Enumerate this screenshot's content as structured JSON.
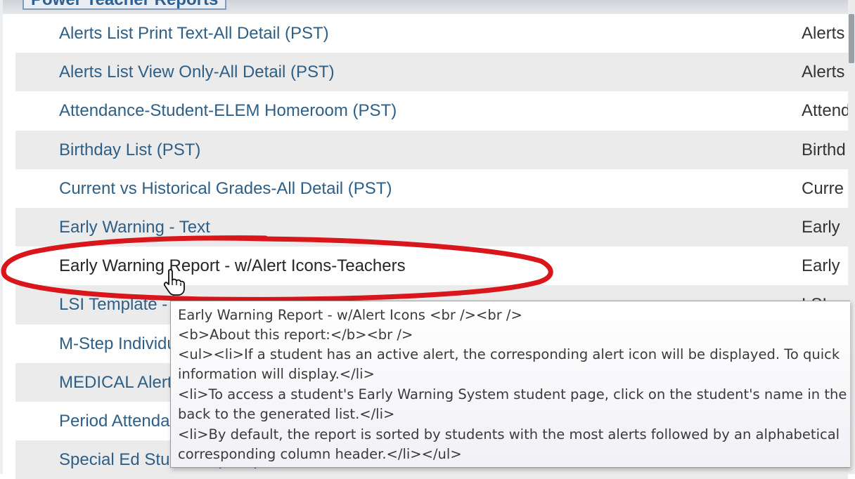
{
  "section": {
    "title": "Power Teacher Reports"
  },
  "reports": [
    {
      "name": "Alerts List Print Text-All Detail (PST)",
      "category": "Alerts"
    },
    {
      "name": "Alerts List View Only-All Detail (PST)",
      "category": "Alerts"
    },
    {
      "name": "Attendance-Student-ELEM Homeroom (PST)",
      "category": "Attend"
    },
    {
      "name": "Birthday List (PST)",
      "category": "Birthd"
    },
    {
      "name": "Current vs Historical Grades-All Detail (PST)",
      "category": "Curre"
    },
    {
      "name": "Early Warning - Text",
      "category": "Early"
    },
    {
      "name": "Early Warning Report - w/Alert Icons-Teachers",
      "category": "Early"
    },
    {
      "name": "LSI Template - Report (PST)",
      "category": "LSI"
    },
    {
      "name": "M-Step Individual",
      "category": ""
    },
    {
      "name": "MEDICAL Alerts",
      "category": ""
    },
    {
      "name": "Period Attendance",
      "category": ""
    },
    {
      "name": "Special Ed Students (PST)",
      "category": ""
    }
  ],
  "tooltip": {
    "lines": [
      "Early Warning Report - w/Alert Icons <br /><br />",
      "<b>About this report:</b><br />",
      "<ul><li>If a student has an active alert, the corresponding alert icon will be displayed. To quick",
      "information will display.</li>",
      "<li>To access a student's Early Warning System student page, click on the student's name in the",
      "back to the generated list.</li>",
      "<li>By default, the report is sorted by students with the most alerts followed by an alphabetical",
      "corresponding column header.</li></ul>"
    ]
  },
  "colors": {
    "link": "#2e5f87",
    "row_alt": "#ebebeb",
    "highlight": "#d9161c"
  },
  "icons": {
    "cursor": "hand-pointer-icon"
  }
}
